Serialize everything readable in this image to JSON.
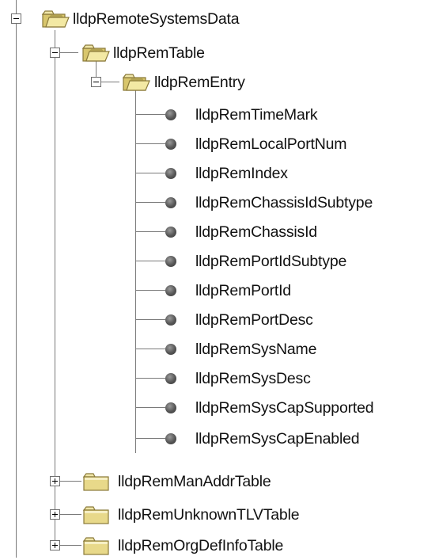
{
  "tree": {
    "root": {
      "label": "lldpRemoteSystemsData",
      "expanded": true
    },
    "table": {
      "label": "lldpRemTable",
      "expanded": true
    },
    "entry": {
      "label": "lldpRemEntry",
      "expanded": true
    },
    "leaves": [
      "lldpRemTimeMark",
      "lldpRemLocalPortNum",
      "lldpRemIndex",
      "lldpRemChassisIdSubtype",
      "lldpRemChassisId",
      "lldpRemPortIdSubtype",
      "lldpRemPortId",
      "lldpRemPortDesc",
      "lldpRemSysName",
      "lldpRemSysDesc",
      "lldpRemSysCapSupported",
      "lldpRemSysCapEnabled"
    ],
    "collapsed_tables": [
      {
        "label": "lldpRemManAddrTable",
        "expanded": false
      },
      {
        "label": "lldpRemUnknownTLVTable",
        "expanded": false
      },
      {
        "label": "lldpRemOrgDefInfoTable",
        "expanded": false
      }
    ]
  },
  "icons": {
    "folder": "folder-icon",
    "open_folder": "open-folder-icon",
    "leaf": "leaf-node-icon",
    "expand": "expand-plus-icon",
    "collapse": "collapse-minus-icon"
  },
  "colors": {
    "folder_body": "#e8d98a",
    "folder_tab": "#f0e6a8",
    "folder_border": "#8a7a3a",
    "tree_lines": "#7a7a7a",
    "leaf_dot": "#555555"
  }
}
